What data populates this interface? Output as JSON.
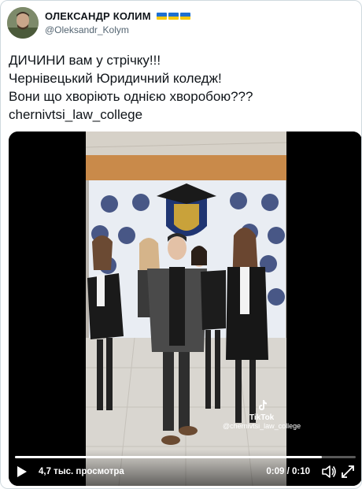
{
  "author": {
    "display_name": "ОЛЕКСАНДР КОЛИМ",
    "handle": "@Oleksandr_Kolym",
    "flag_emoji_count": 3
  },
  "tweet": {
    "lines": [
      "ДИЧИНИ вам у стрічку!!!",
      "Чернівецький Юридичний коледж!",
      "Вони що хворіють однією хворобою???",
      "chernivtsi_law_college"
    ]
  },
  "video": {
    "views": "4,7 тыс. просмотра",
    "time": "0:09 / 0:10",
    "progress": 0.9,
    "watermark_brand": "TikTok",
    "watermark_handle": "@chernivtsi_law_college"
  },
  "icons": {
    "play": "play-icon",
    "volume": "volume-icon",
    "fullscreen": "fullscreen-icon"
  },
  "colors": {
    "flag_blue": "#1d6fd1",
    "flag_yellow": "#f6c90e",
    "handle_gray": "#536471"
  }
}
